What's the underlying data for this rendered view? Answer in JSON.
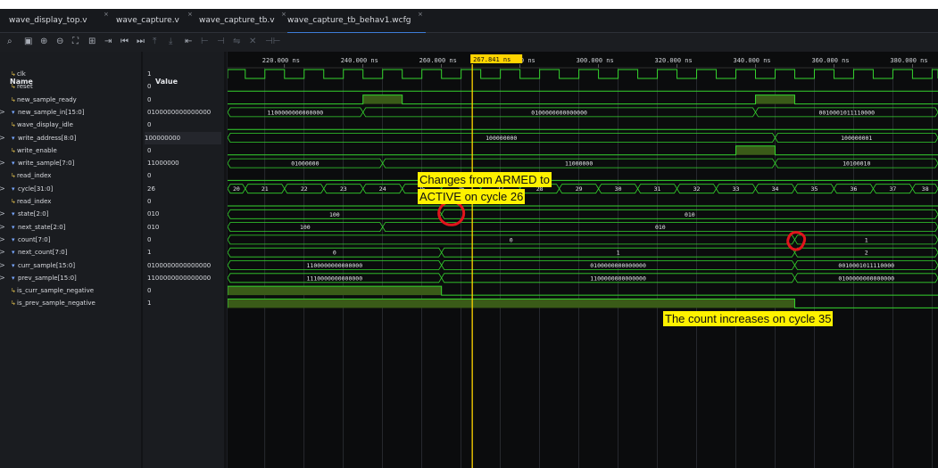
{
  "tabs": [
    {
      "label": "wave_display_top.v",
      "close": "×"
    },
    {
      "label": "wave_capture.v",
      "close": "×"
    },
    {
      "label": "wave_capture_tb.v",
      "close": "×"
    },
    {
      "label": "wave_capture_tb_behav1.wcfg",
      "close": "×"
    }
  ],
  "toolbar_icons": [
    "search-icon",
    "save-icon",
    "zoom-in-icon",
    "zoom-out-icon",
    "zoom-fit-icon",
    "go-to-cursor-icon",
    "add-marker-icon",
    "go-to-start-icon",
    "go-to-end-icon",
    "prev-transition-icon",
    "next-transition-icon",
    "add-cursor-icon",
    "prev-edge-icon",
    "next-edge-icon",
    "swap-cursors-icon",
    "remove-marker-icon",
    "snap-icon"
  ],
  "panel": {
    "name_header": "Name",
    "value_header": "Value",
    "expand_glyph": ">"
  },
  "signals": [
    {
      "name": "clk",
      "value": "1",
      "bus": false
    },
    {
      "name": "reset",
      "value": "0",
      "bus": false
    },
    {
      "name": "new_sample_ready",
      "value": "0",
      "bus": false
    },
    {
      "name": "new_sample_in[15:0]",
      "value": "0100000000000000",
      "bus": true
    },
    {
      "name": "wave_display_idle",
      "value": "0",
      "bus": false
    },
    {
      "name": "write_address[8:0]",
      "value": "100000000",
      "bus": true
    },
    {
      "name": "write_enable",
      "value": "0",
      "bus": false
    },
    {
      "name": "write_sample[7:0]",
      "value": "11000000",
      "bus": true
    },
    {
      "name": "read_index",
      "value": "0",
      "bus": false
    },
    {
      "name": "cycle[31:0]",
      "value": "26",
      "bus": true
    },
    {
      "name": "read_index",
      "value": "0",
      "bus": false
    },
    {
      "name": "state[2:0]",
      "value": "010",
      "bus": true
    },
    {
      "name": "next_state[2:0]",
      "value": "010",
      "bus": true
    },
    {
      "name": "count[7:0]",
      "value": "0",
      "bus": true
    },
    {
      "name": "next_count[7:0]",
      "value": "1",
      "bus": true
    },
    {
      "name": "curr_sample[15:0]",
      "value": "0100000000000000",
      "bus": true
    },
    {
      "name": "prev_sample[15:0]",
      "value": "1100000000000000",
      "bus": true
    },
    {
      "name": "is_curr_sample_negative",
      "value": "0",
      "bus": false
    },
    {
      "name": "is_prev_sample_negative",
      "value": "1",
      "bus": false
    }
  ],
  "cursor": {
    "time_label": "267.841 ns"
  },
  "time_axis": {
    "start_ns": 205.5,
    "end_ns": 386.5,
    "clock_period_ns": 10,
    "labels": [
      "220.000 ns",
      "240.000 ns",
      "260.000 ns",
      "280.000 ns",
      "300.000 ns",
      "320.000 ns",
      "340.000 ns",
      "360.000 ns",
      "380.000 ns"
    ]
  },
  "waves": {
    "clk_start_ns": 205,
    "clk_period_ns": 10,
    "clk_high_first": true,
    "reset": {
      "level": "low"
    },
    "new_sample_ready": {
      "pulses_ns": [
        [
          240,
          250
        ],
        [
          340,
          350
        ]
      ]
    },
    "new_sample_in": [
      {
        "from": 205.5,
        "to": 240,
        "label": "1100000000000000"
      },
      {
        "from": 240,
        "to": 340,
        "label": "0100000000000000"
      },
      {
        "from": 340,
        "to": 386.5,
        "label": "0010001011110000"
      }
    ],
    "wave_display_idle": {
      "level": "low"
    },
    "write_address": [
      {
        "from": 205.5,
        "to": 345,
        "label": "100000000"
      },
      {
        "from": 345,
        "to": 386.5,
        "label": "100000001"
      }
    ],
    "write_enable": {
      "pulses_ns": [
        [
          335,
          345
        ]
      ]
    },
    "write_sample": [
      {
        "from": 205.5,
        "to": 245,
        "label": "01000000"
      },
      {
        "from": 245,
        "to": 345,
        "label": "11000000"
      },
      {
        "from": 345,
        "to": 386.5,
        "label": "10100010"
      }
    ],
    "read_index_a": {
      "level": "low"
    },
    "cycle": [
      {
        "from": 205.5,
        "to": 210,
        "label": "20"
      },
      {
        "from": 210,
        "to": 220,
        "label": "21"
      },
      {
        "from": 220,
        "to": 230,
        "label": "22"
      },
      {
        "from": 230,
        "to": 240,
        "label": "23"
      },
      {
        "from": 240,
        "to": 250,
        "label": "24"
      },
      {
        "from": 250,
        "to": 260,
        "label": "25"
      },
      {
        "from": 260,
        "to": 270,
        "label": "26"
      },
      {
        "from": 270,
        "to": 280,
        "label": "27"
      },
      {
        "from": 280,
        "to": 290,
        "label": "28"
      },
      {
        "from": 290,
        "to": 300,
        "label": "29"
      },
      {
        "from": 300,
        "to": 310,
        "label": "30"
      },
      {
        "from": 310,
        "to": 320,
        "label": "31"
      },
      {
        "from": 320,
        "to": 330,
        "label": "32"
      },
      {
        "from": 330,
        "to": 340,
        "label": "33"
      },
      {
        "from": 340,
        "to": 350,
        "label": "34"
      },
      {
        "from": 350,
        "to": 360,
        "label": "35"
      },
      {
        "from": 360,
        "to": 370,
        "label": "36"
      },
      {
        "from": 370,
        "to": 380,
        "label": "37"
      },
      {
        "from": 380,
        "to": 386.5,
        "label": "38"
      }
    ],
    "read_index_b": {
      "level": "low"
    },
    "state": [
      {
        "from": 205.5,
        "to": 260,
        "label": "100"
      },
      {
        "from": 260,
        "to": 386.5,
        "label": "010"
      }
    ],
    "next_state": [
      {
        "from": 205.5,
        "to": 245,
        "label": "100"
      },
      {
        "from": 245,
        "to": 386.5,
        "label": "010"
      }
    ],
    "count": [
      {
        "from": 205.5,
        "to": 350,
        "label": "0"
      },
      {
        "from": 350,
        "to": 386.5,
        "label": "1"
      }
    ],
    "next_count": [
      {
        "from": 205.5,
        "to": 260,
        "label": "0"
      },
      {
        "from": 260,
        "to": 350,
        "label": "1"
      },
      {
        "from": 350,
        "to": 386.5,
        "label": "2"
      }
    ],
    "curr_sample": [
      {
        "from": 205.5,
        "to": 260,
        "label": "1100000000000000"
      },
      {
        "from": 260,
        "to": 350,
        "label": "0100000000000000"
      },
      {
        "from": 350,
        "to": 386.5,
        "label": "0010001011110000"
      }
    ],
    "prev_sample": [
      {
        "from": 205.5,
        "to": 260,
        "label": "1110000000000000"
      },
      {
        "from": 260,
        "to": 350,
        "label": "1100000000000000"
      },
      {
        "from": 350,
        "to": 386.5,
        "label": "0100000000000000"
      }
    ],
    "is_curr_sample_negative": {
      "high_ranges_ns": [
        [
          205.5,
          260
        ]
      ]
    },
    "is_prev_sample_negative": {
      "high_ranges_ns": [
        [
          205.5,
          350
        ]
      ]
    }
  },
  "annotations": {
    "armed_line1": "Changes from ARMED to",
    "armed_line2": "ACTIVE on cycle 26",
    "count_note": "The count increases on cycle 35"
  },
  "colors": {
    "wave": "#35d42e",
    "bus_fill": "#2f4a1c",
    "high_fill": "#3a5b18",
    "cursor": "#ffd400",
    "highlight": "#fff200",
    "circle": "#e2141c",
    "icon_scalar": "#d7b84c",
    "icon_bus": "#79a8ff",
    "tab_accent": "#3d7dd8"
  }
}
